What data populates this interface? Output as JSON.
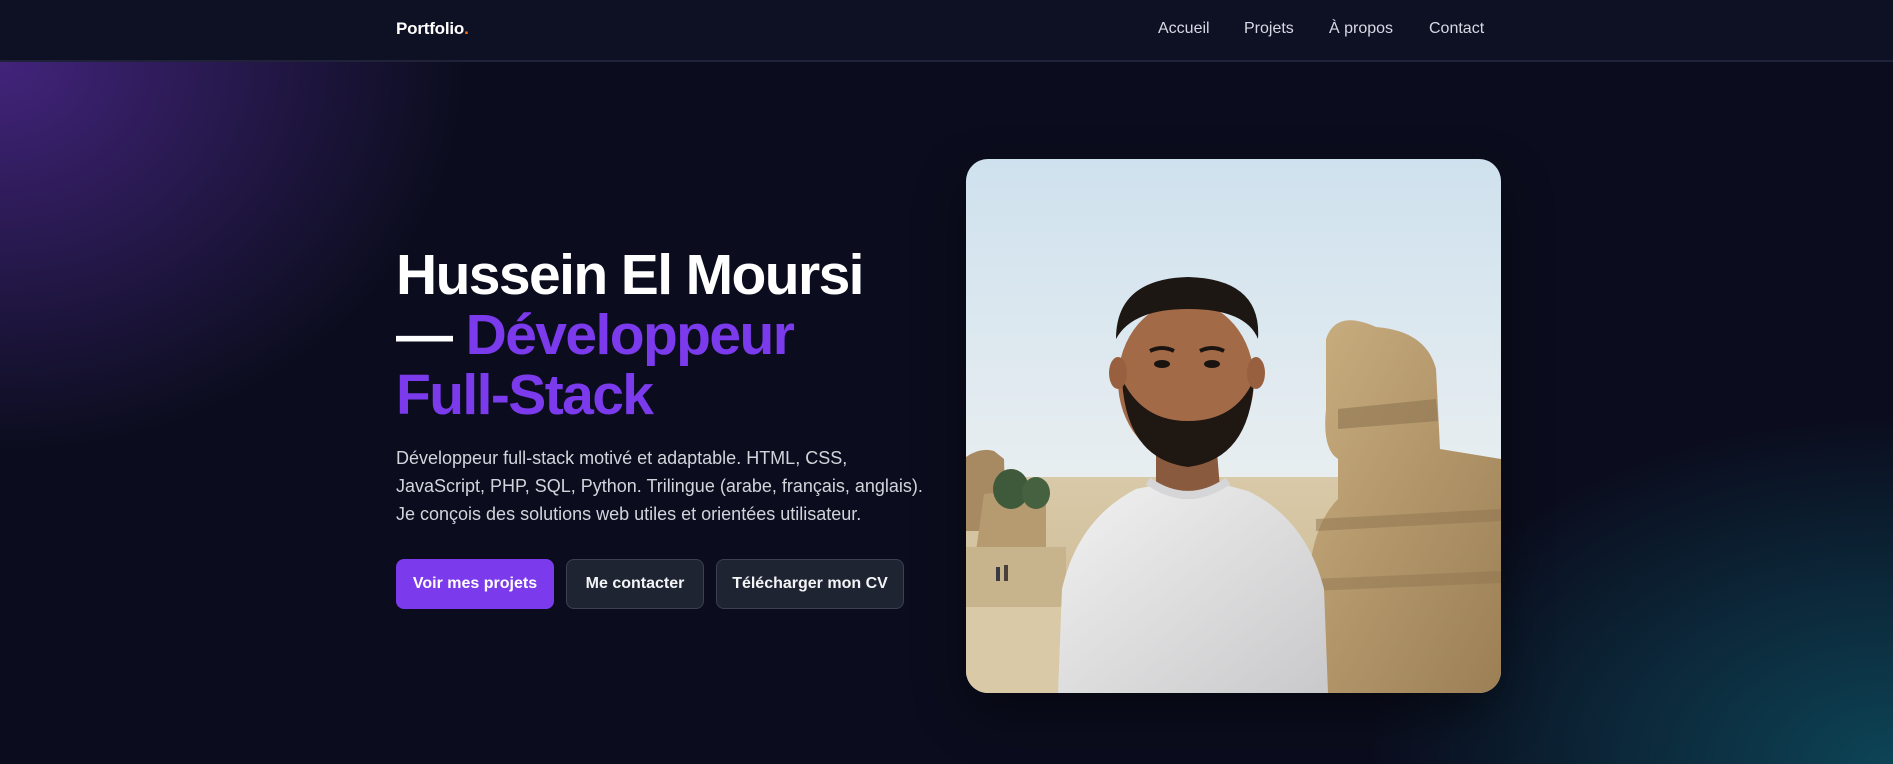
{
  "nav": {
    "logo_text": "Portfolio",
    "logo_dot": ".",
    "links": [
      {
        "label": "Accueil"
      },
      {
        "label": "Projets"
      },
      {
        "label": "À propos"
      },
      {
        "label": "Contact"
      }
    ]
  },
  "hero": {
    "title_name": "Hussein El Moursi",
    "title_dash": "— ",
    "title_role_1": "Développeur",
    "title_role_2": "Full-Stack",
    "description": "Développeur full-stack motivé et adaptable. HTML, CSS, JavaScript, PHP, SQL, Python. Trilingue (arabe, français, anglais). Je conçois des solutions web utiles et orientées utilisateur.",
    "buttons": {
      "projects": "Voir mes projets",
      "contact": "Me contacter",
      "cv": "Télécharger mon CV"
    }
  },
  "colors": {
    "accent": "#7c3aed",
    "logo_dot": "#f97316",
    "background": "#0b0d1e"
  }
}
